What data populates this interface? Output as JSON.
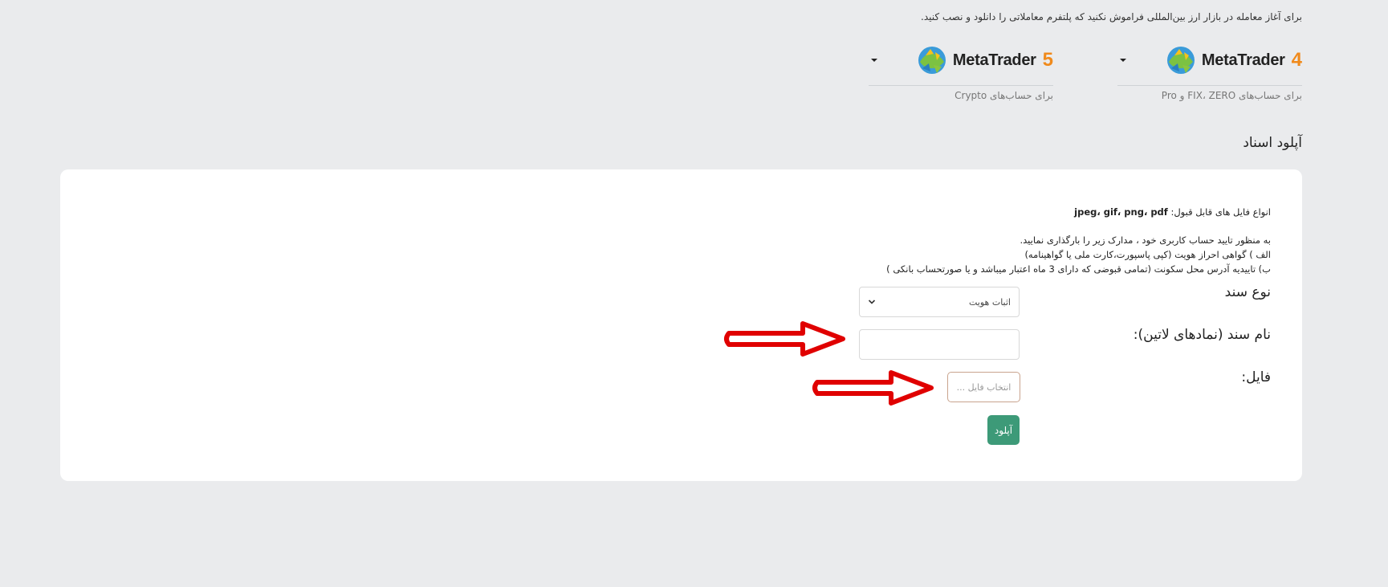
{
  "top_note": "برای آغاز معامله در بازار ارز بین‌المللی فراموش نکنید که پلتفرم معاملاتی را دانلود و نصب کنید.",
  "platforms": [
    {
      "name": "MetaTrader",
      "version": "4",
      "subtitle": "برای حساب‌های FIX، ZERO و Pro",
      "icon": "metatrader-logo-icon"
    },
    {
      "name": "MetaTrader",
      "version": "5",
      "subtitle": "برای حساب‌های Crypto",
      "icon": "metatrader-logo-icon"
    }
  ],
  "section_title": "آپلود اسناد",
  "info": {
    "accepted_types_label": "انواع فایل های قابل قبول:",
    "accepted_types": "jpeg، gif، png، pdf",
    "line1": "به منظور تایید حساب کاربری خود ، مدارک زیر را بارگذاری نمایید.",
    "line2": "الف ) گواهی احراز هویت (کپی پاسپورت،کارت ملی یا گواهینامه)",
    "line3": "ب) تاییدیه آدرس محل سکونت (تمامی قبوضی که دارای 3 ماه اعتبار میباشد و یا صورتحساب بانکی )"
  },
  "form": {
    "doc_type_label": "نوع سند",
    "doc_type_value": "اثبات هویت",
    "doc_name_label": "نام سند (نمادهای لاتین):",
    "doc_name_value": "",
    "file_label": "فایل:",
    "file_button": "انتخاب فایل ...",
    "upload_button": "آپلود"
  },
  "colors": {
    "background": "#eaebed",
    "card": "#ffffff",
    "upload_button": "#3d9a78",
    "accent_orange": "#f08a1c",
    "annotation_arrow": "#e00000"
  }
}
